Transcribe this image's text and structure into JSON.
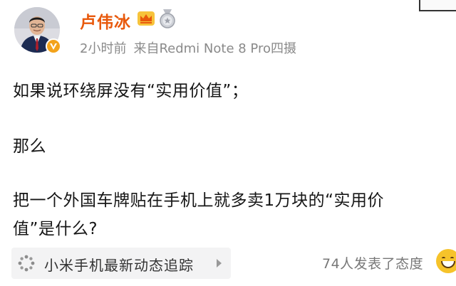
{
  "post": {
    "author": {
      "name": "卢伟冰",
      "badges": [
        "crown-badge",
        "medal-badge"
      ],
      "verified_color": "#f3a31b"
    },
    "meta": {
      "time": "2小时前",
      "source": "来自Redmi Note 8 Pro四摄"
    },
    "content": {
      "line1": "如果说环绕屏没有“实用价值”；",
      "line2": "那么",
      "line3": "把一个外国车牌贴在手机上就多卖1万块的“实用价",
      "line4": "值”是什么?"
    },
    "topic": {
      "label": "小米手机最新动态追踪",
      "icon": "loading-dots-icon"
    },
    "reactions": {
      "text": "74人发表了态度",
      "icon": "laugh-emoji-icon"
    },
    "colors": {
      "username": "#e8590c",
      "meta": "#8a8a8a",
      "topic_bg": "#f3f3f4"
    }
  }
}
